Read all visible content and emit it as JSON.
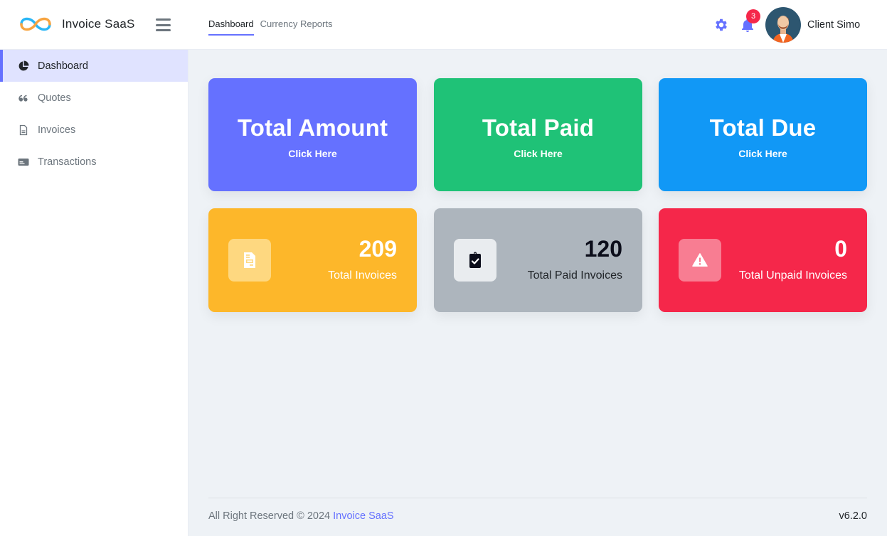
{
  "app": {
    "brand": "Invoice SaaS"
  },
  "header": {
    "tabs": [
      {
        "label": "Dashboard",
        "active": true
      },
      {
        "label": "Currency Reports",
        "active": false
      }
    ],
    "notifications_count": "3",
    "user_name": "Client Simo",
    "icons": {
      "settings": "gear-icon",
      "notifications": "bell-icon",
      "menu": "hamburger-icon"
    }
  },
  "sidebar": {
    "items": [
      {
        "label": "Dashboard",
        "icon": "pie-chart-icon",
        "active": true
      },
      {
        "label": "Quotes",
        "icon": "quote-icon",
        "active": false
      },
      {
        "label": "Invoices",
        "icon": "file-icon",
        "active": false
      },
      {
        "label": "Transactions",
        "icon": "credit-card-icon",
        "active": false
      }
    ]
  },
  "summary_cards": [
    {
      "title": "Total Amount",
      "action": "Click Here",
      "color": "#6571ff"
    },
    {
      "title": "Total Paid",
      "action": "Click Here",
      "color": "#1fc277"
    },
    {
      "title": "Total Due",
      "action": "Click Here",
      "color": "#1198f6"
    }
  ],
  "stat_cards": [
    {
      "value": "209",
      "label": "Total Invoices",
      "icon": "invoice-icon",
      "color": "#fdb72a"
    },
    {
      "value": "120",
      "label": "Total Paid Invoices",
      "icon": "clipboard-check-icon",
      "color": "#adb5bd"
    },
    {
      "value": "0",
      "label": "Total Unpaid Invoices",
      "icon": "warning-icon",
      "color": "#f5274a"
    }
  ],
  "footer": {
    "copyright": "All Right Reserved © 2024",
    "brand_link": "Invoice SaaS",
    "version": "v6.2.0"
  },
  "colors": {
    "accent": "#6571ff",
    "badge": "#f5274a"
  }
}
